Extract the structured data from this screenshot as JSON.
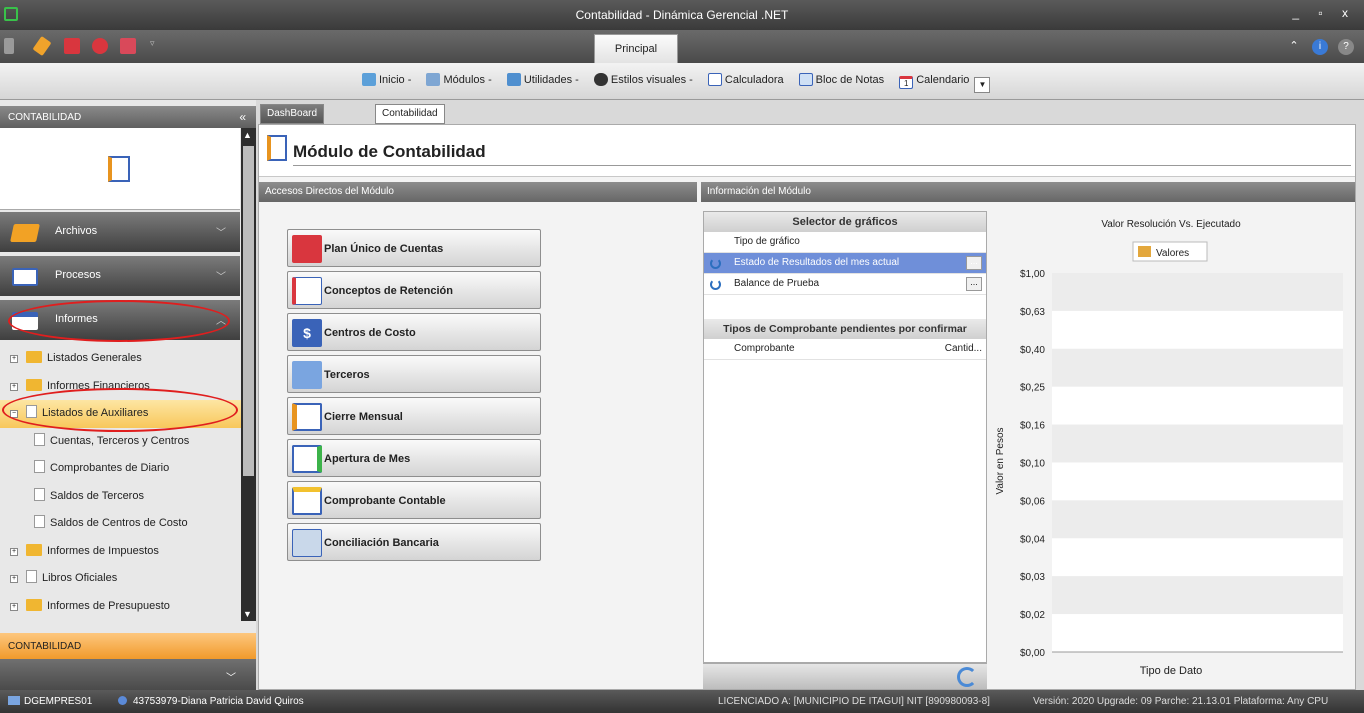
{
  "window": {
    "title": "Contabilidad - Dinámica Gerencial .NET",
    "controls": "_ ▫ x"
  },
  "ribbon": {
    "tab_label": "Principal"
  },
  "toolbar": {
    "items": [
      {
        "label": "Inicio -",
        "icon": "home-icon"
      },
      {
        "label": "Módulos -",
        "icon": "modules-icon"
      },
      {
        "label": "Utilidades -",
        "icon": "utilities-icon"
      },
      {
        "label": "Estilos visuales -",
        "icon": "palette-icon"
      },
      {
        "label": "Calculadora",
        "icon": "calculator-icon"
      },
      {
        "label": "Bloc de Notas",
        "icon": "notepad-icon"
      },
      {
        "label": "Calendario",
        "icon": "calendar-icon"
      }
    ],
    "calendar_day": "1"
  },
  "sidebar": {
    "header": "CONTABILIDAD",
    "collapse_glyph": "«",
    "sections": [
      {
        "label": "Archivos"
      },
      {
        "label": "Procesos"
      },
      {
        "label": "Informes"
      }
    ],
    "tree": [
      {
        "label": "Listados Generales"
      },
      {
        "label": "Informes Financieros"
      },
      {
        "label": "Listados de Auxiliares"
      },
      {
        "label": "Cuentas, Terceros y Centros"
      },
      {
        "label": "Comprobantes de Diario"
      },
      {
        "label": "Saldos de Terceros"
      },
      {
        "label": "Saldos de Centros de Costo"
      },
      {
        "label": "Informes de Impuestos"
      },
      {
        "label": "Libros Oficiales"
      },
      {
        "label": "Informes de Presupuesto"
      }
    ],
    "footer": "CONTABILIDAD"
  },
  "doc_tabs": [
    {
      "label": "DashBoard Principal"
    },
    {
      "label": "Contabilidad"
    }
  ],
  "module": {
    "title": "Módulo de Contabilidad",
    "shortcuts_header": "Accesos Directos del Módulo",
    "info_header": "Información del Módulo",
    "shortcuts": [
      {
        "label": "Plan Único de Cuentas"
      },
      {
        "label": "Conceptos de Retención"
      },
      {
        "label": "Centros de Costo"
      },
      {
        "label": "Terceros"
      },
      {
        "label": "Cierre Mensual"
      },
      {
        "label": "Apertura de Mes"
      },
      {
        "label": "Comprobante Contable"
      },
      {
        "label": "Conciliación Bancaria"
      }
    ]
  },
  "selector": {
    "title": "Selector de gráficos",
    "column": "Tipo de gráfico",
    "rows": [
      {
        "label": "Estado de Resultados del mes actual",
        "selected": true
      },
      {
        "label": "Balance de Prueba",
        "selected": false
      }
    ],
    "button_glyph": "..."
  },
  "pending": {
    "title": "Tipos de Comprobante pendientes por confirmar",
    "col1": "Comprobante",
    "col2": "Cantid..."
  },
  "chart_data": {
    "type": "bar",
    "title": "Valor Resolución Vs. Ejecutado",
    "ylabel": "Valor en Pesos",
    "xlabel": "Tipo de Dato",
    "legend": [
      "Valores"
    ],
    "legend_position": "top-center",
    "y_ticks": [
      "$1,00",
      "$0,63",
      "$0,40",
      "$0,25",
      "$0,16",
      "$0,10",
      "$0,06",
      "$0,04",
      "$0,03",
      "$0,02",
      "$0,00"
    ],
    "categories": [],
    "series": [],
    "colors": {
      "legend_swatch": "#e3a73c",
      "band": "#ececec"
    }
  },
  "statusbar": {
    "company": "DGEMPRES01",
    "user": "43753979-Diana Patricia David Quiros",
    "license": "LICENCIADO A: [MUNICIPIO DE ITAGUI] NIT [890980093-8]",
    "version": "Versión: 2020 Upgrade: 09 Parche: 21.13.01 Plataforma: Any CPU"
  }
}
